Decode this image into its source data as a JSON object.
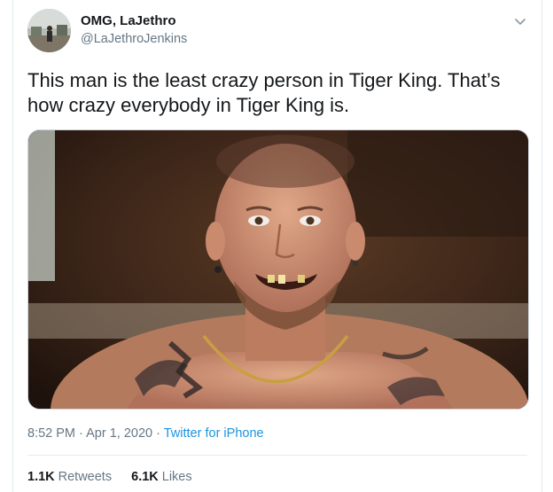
{
  "tweet": {
    "display_name": "OMG, LaJethro",
    "handle": "@LaJethroJenkins",
    "text": "This man is the least crazy person in Tiger King. That’s how crazy everybody in Tiger King is.",
    "time": "8:52 PM",
    "separator_1": "·",
    "date": "Apr 1, 2020",
    "separator_2": "·",
    "source": "Twitter for iPhone",
    "retweets_count": "1.1K",
    "retweets_label": "Retweets",
    "likes_count": "6.1K",
    "likes_label": "Likes"
  },
  "icons": {
    "menu": "chevron-down-icon"
  },
  "colors": {
    "text": "#14171a",
    "secondary": "#657786",
    "link": "#1b95e0",
    "border": "#e1e8ed"
  }
}
